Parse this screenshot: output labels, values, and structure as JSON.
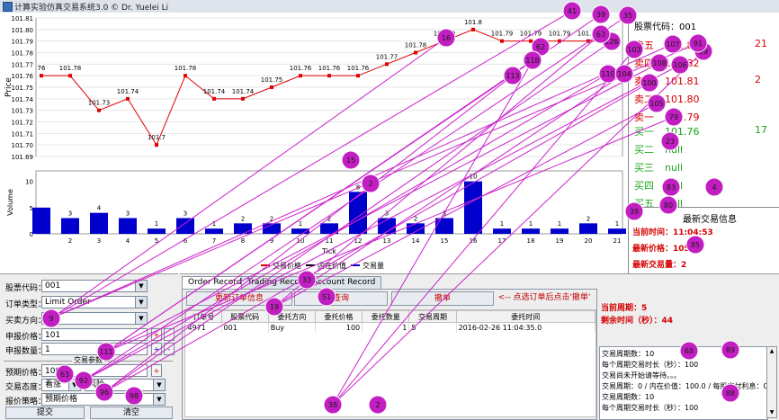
{
  "window": {
    "title": "计算实验仿真交易系统3.0 © Dr. Yuelei Li"
  },
  "chart_data": {
    "type": "line",
    "ylabel": "Price",
    "xlabel": "Tick",
    "ylim": [
      101.69,
      101.81
    ],
    "yticks": [
      "101.81",
      "101.80",
      "101.79",
      "101.78",
      "101.77",
      "101.76",
      "101.75",
      "101.74",
      "101.73",
      "101.72",
      "101.71",
      "101.70",
      "101.69"
    ],
    "x": [
      1,
      2,
      3,
      4,
      5,
      6,
      7,
      8,
      9,
      10,
      11,
      12,
      13,
      14,
      15,
      16,
      17,
      18,
      19,
      20,
      21
    ],
    "xticks": [
      "2",
      "3",
      "4",
      "5",
      "6",
      "7",
      "8",
      "9",
      "10",
      "11",
      "12",
      "13",
      "14",
      "15",
      "16",
      "17",
      "18",
      "19",
      "20",
      "21"
    ],
    "price_labels": [
      "76",
      "101.78",
      "101.73",
      "101.74",
      "101.7",
      "101.78",
      "101.74",
      "101.74",
      "101.75",
      "101.76",
      "101.76",
      "101.76",
      "101.77",
      "101.78",
      "101.79",
      "101.8",
      "101.79",
      "101.79",
      "101.79",
      "101.79"
    ],
    "series": [
      {
        "name": "交易价格",
        "color": "#e00000",
        "values": [
          101.76,
          101.76,
          101.73,
          101.74,
          101.7,
          101.76,
          101.74,
          101.74,
          101.75,
          101.76,
          101.76,
          101.76,
          101.77,
          101.78,
          101.79,
          101.8,
          101.79,
          101.79,
          101.79,
          101.79,
          101.79
        ]
      }
    ],
    "volume": {
      "ylabel": "Volume",
      "ylim": [
        0,
        12
      ],
      "yticks": [
        "10",
        "5",
        "0"
      ],
      "values": [
        5,
        3,
        4,
        3,
        1,
        3,
        1,
        2,
        2,
        1,
        2,
        8,
        3,
        2,
        3,
        10,
        1,
        1,
        1,
        2,
        1
      ],
      "labels": [
        "",
        "3",
        "4",
        "3",
        "1",
        "3",
        "1",
        "2",
        "2",
        "1",
        "2",
        "8",
        "3",
        "2",
        "3",
        "10",
        "1",
        "1",
        "1",
        "2",
        "1"
      ]
    },
    "legend": [
      {
        "name": "交易价格",
        "color": "#e00000"
      },
      {
        "name": "内在价值",
        "color": "#000000"
      },
      {
        "name": "交易量",
        "color": "#0000cc"
      }
    ],
    "legend_position": "bottom"
  },
  "market_depth": {
    "stock_code_label": "股票代码：001",
    "asks": [
      {
        "label": "卖五",
        "value": "101.83"
      },
      {
        "label": "卖四",
        "value": "101.82"
      },
      {
        "label": "卖三",
        "value": "101.81"
      },
      {
        "label": "卖二",
        "value": "101.80"
      },
      {
        "label": "卖一",
        "value": "101.79"
      }
    ],
    "bids": [
      {
        "label": "买一",
        "value": "101.76"
      },
      {
        "label": "买二",
        "value": "null"
      },
      {
        "label": "买三",
        "value": "null"
      },
      {
        "label": "买四",
        "value": "null"
      },
      {
        "label": "买五",
        "value": "null"
      }
    ],
    "ask_sizes": [
      "21",
      "2"
    ],
    "bid_size": "17"
  },
  "latest_info": {
    "title": "最新交易信息",
    "time": "当前时间：11:04:53",
    "price": "最新价格：105.1",
    "volume": "最新交易量：2"
  },
  "form": {
    "stock_label": "股票代码：",
    "stock_value": "001",
    "order_type_label": "订单类型：",
    "order_type_value": "Limit Order",
    "direction_label": "买卖方向：",
    "direction_value": "Buy",
    "price_label": "申报价格：",
    "price_value": "101",
    "qty_label": "申报数量：",
    "qty_value": "1",
    "plus": "+",
    "minus": "-",
    "section_label": "交易参数",
    "expect_label": "预期价格：",
    "expect_value": "100",
    "attitude_label": "交易态度：",
    "attitude_value": "看涨",
    "attitude_extra": "风险",
    "quote_label": "报价策略：",
    "quote_value": "预期价格",
    "submit_label": "提交",
    "clear_label": "清空"
  },
  "order_panel": {
    "tabs": [
      "Order Record",
      "Trading Record",
      "Account Record"
    ],
    "btn_update": "更新订单信息",
    "btn_query": "查询",
    "btn_cancel": "撤单",
    "hint": "<-- 点选订单后点击'撤单'",
    "columns": [
      "订单号",
      "股票代码",
      "委托方向",
      "委托价格",
      "委托数量",
      "交易周期",
      "委托时间"
    ],
    "rows": [
      [
        "4971",
        "001",
        "Buy",
        "100",
        "1",
        "5",
        "2016-02-26 11:04:35.0"
      ]
    ]
  },
  "session": {
    "period": "当前周期：5",
    "remaining": "剩余时间（秒）：44",
    "log": [
      "交易周期数：10",
      "每个周期交易时长（秒）：100",
      "交易尚未开始请等待。。。",
      "交易周期：0 / 内在价值：100.0 / 每股支付利息：0.0",
      "交易周期数：10",
      "每个周期交易时长（秒）：100"
    ]
  },
  "overlay_markers": [
    "41",
    "39",
    "35",
    "126",
    "63",
    "62",
    "16",
    "118",
    "110",
    "113",
    "104",
    "103",
    "107",
    "108",
    "106",
    "100",
    "105",
    "99",
    "91",
    "79",
    "23",
    "83",
    "80",
    "4",
    "85",
    "33",
    "19",
    "15",
    "2",
    "51",
    "39",
    "9",
    "111",
    "63",
    "92",
    "96",
    "98",
    "88",
    "68",
    "89",
    "38",
    "2"
  ]
}
